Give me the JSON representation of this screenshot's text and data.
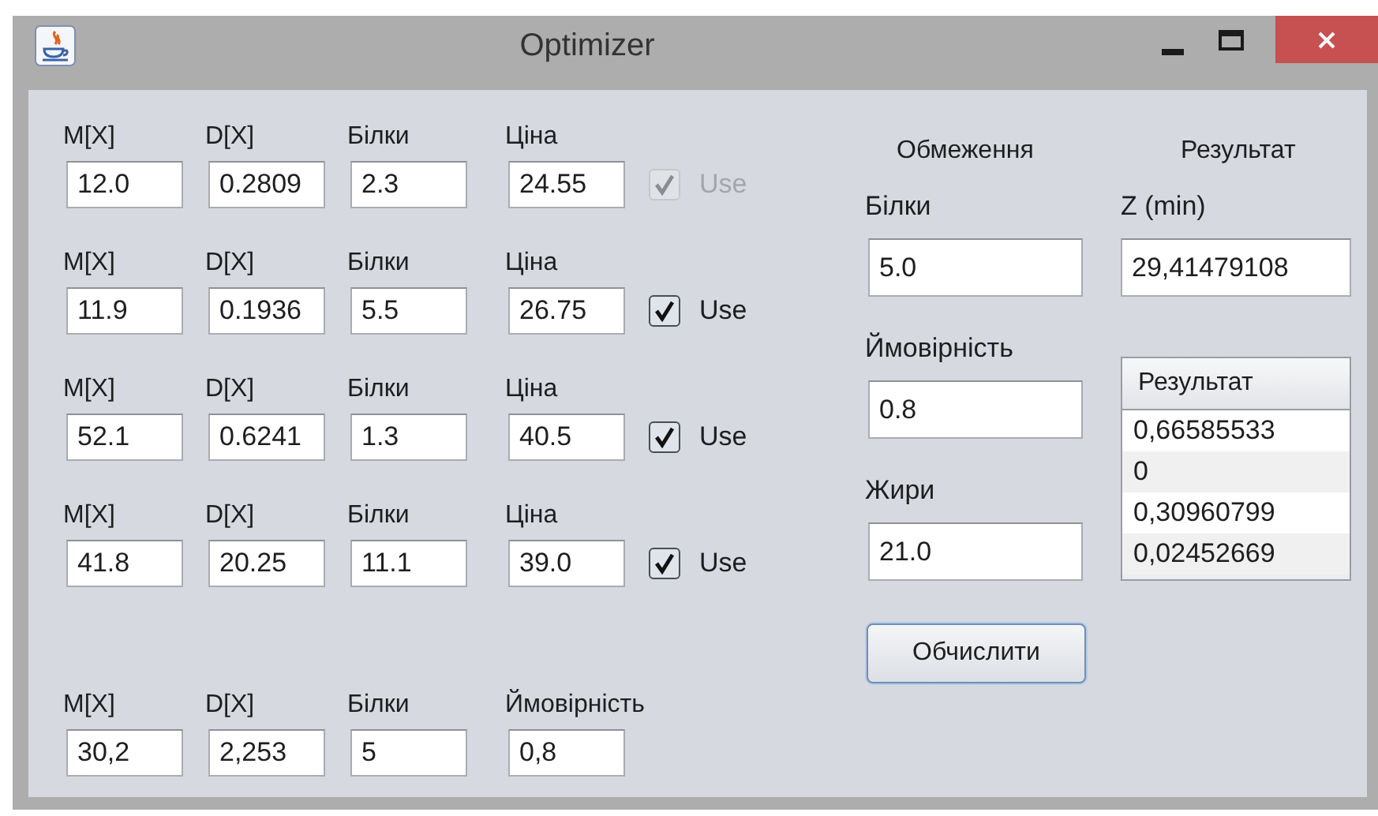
{
  "window": {
    "title": "Optimizer"
  },
  "groups": [
    {
      "kind": "item",
      "fields": [
        {
          "label": "M[X]",
          "value": "12.0"
        },
        {
          "label": "D[X]",
          "value": "0.2809"
        },
        {
          "label": "Білки",
          "value": "2.3"
        },
        {
          "label": "Ціна",
          "value": "24.55"
        }
      ],
      "use": {
        "label": "Use",
        "checked": true,
        "disabled": true
      }
    },
    {
      "kind": "item",
      "fields": [
        {
          "label": "M[X]",
          "value": "11.9"
        },
        {
          "label": "D[X]",
          "value": "0.1936"
        },
        {
          "label": "Білки",
          "value": "5.5"
        },
        {
          "label": "Ціна",
          "value": "26.75"
        }
      ],
      "use": {
        "label": "Use",
        "checked": true,
        "disabled": false
      }
    },
    {
      "kind": "item",
      "fields": [
        {
          "label": "M[X]",
          "value": "52.1"
        },
        {
          "label": "D[X]",
          "value": "0.6241"
        },
        {
          "label": "Білки",
          "value": "1.3"
        },
        {
          "label": "Ціна",
          "value": "40.5"
        }
      ],
      "use": {
        "label": "Use",
        "checked": true,
        "disabled": false
      }
    },
    {
      "kind": "item",
      "fields": [
        {
          "label": "M[X]",
          "value": "41.8"
        },
        {
          "label": "D[X]",
          "value": "20.25"
        },
        {
          "label": "Білки",
          "value": "11.1"
        },
        {
          "label": "Ціна",
          "value": "39.0"
        }
      ],
      "use": {
        "label": "Use",
        "checked": true,
        "disabled": false
      }
    },
    {
      "kind": "summary",
      "fields": [
        {
          "label": "M[X]",
          "value": "30,2"
        },
        {
          "label": "D[X]",
          "value": "2,253"
        },
        {
          "label": "Білки",
          "value": "5"
        },
        {
          "label": "Ймовірність",
          "value": "0,8"
        }
      ]
    }
  ],
  "constraints": {
    "heading": "Обмеження",
    "fields": [
      {
        "label": "Білки",
        "value": "5.0"
      },
      {
        "label": "Ймовірність",
        "value": "0.8"
      },
      {
        "label": "Жири",
        "value": "21.0"
      }
    ],
    "button": "Обчислити"
  },
  "result": {
    "heading": "Результат",
    "z_label": "Z (min)",
    "z_value": "29,41479108",
    "table": {
      "columns": [
        "Результат"
      ],
      "rows": [
        "0,66585533",
        "0",
        "0,30960799",
        "0,02452669"
      ]
    }
  }
}
